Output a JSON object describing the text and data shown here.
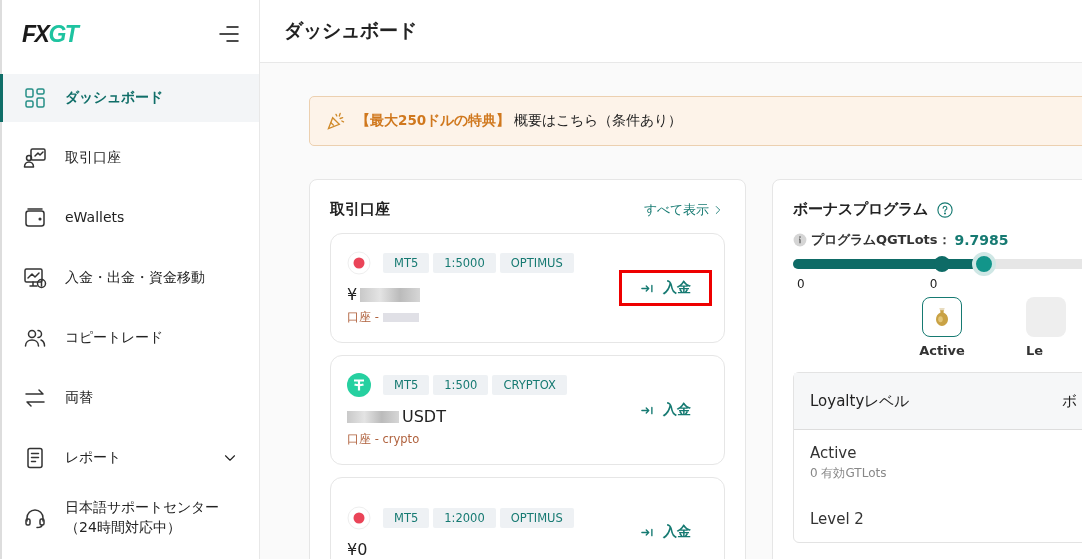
{
  "sidebar": {
    "logo": {
      "dark": "FX",
      "accent": "GT"
    },
    "items": [
      {
        "label": "ダッシュボード",
        "kind": "grid",
        "selected": true
      },
      {
        "label": "取引口座",
        "kind": "account",
        "selected": false
      },
      {
        "label": "eWallets",
        "kind": "wallet",
        "selected": false
      },
      {
        "label": "入金・出金・資金移動",
        "kind": "transfer",
        "selected": false
      },
      {
        "label": "コピートレード",
        "kind": "people",
        "selected": false
      },
      {
        "label": "両替",
        "kind": "exchange",
        "selected": false
      },
      {
        "label": "レポート",
        "kind": "report",
        "selected": false,
        "expanded": false
      },
      {
        "label": "日本語サポートセンター（24時間対応中）",
        "kind": "headset",
        "selected": false
      }
    ]
  },
  "header": {
    "title": "ダッシュボード"
  },
  "banner": {
    "text": "**【最大250ドルの特典】** 概要はこちら（条件あり）"
  },
  "accounts_card": {
    "title": "取引口座",
    "view_all": "すべて表示",
    "accounts": [
      {
        "kind": "jpy",
        "tags": [
          "MT5",
          "1:5000",
          "OPTIMUS"
        ],
        "balance": "¥",
        "balance_hidden": true,
        "account_label": "口座 -",
        "account_hidden": true,
        "deposit": "入金",
        "highlighted": true
      },
      {
        "kind": "usdt",
        "tags": [
          "MT5",
          "1:500",
          "CRYPTOX"
        ],
        "balance": "USDT",
        "balance_hidden": true,
        "account_label": "口座 - crypto",
        "account_hidden": false,
        "deposit": "入金",
        "highlighted": false
      },
      {
        "kind": "jpy",
        "tags": [
          "MT5",
          "1:2000",
          "OPTIMUS"
        ],
        "balance": "¥0",
        "balance_hidden": false,
        "deposit": "入金",
        "highlighted": false
      }
    ]
  },
  "bonus_card": {
    "title": "ボーナスプログラム",
    "lots_label": "プログラムQGTLots：",
    "lots_value": "9.7985",
    "slider": {
      "level": 0.33
    },
    "milestones": [
      "0",
      "0"
    ],
    "tiers": [
      {
        "label": "Active",
        "reached": true
      },
      {
        "label": "Le",
        "reached": false
      }
    ],
    "table": {
      "columns": [
        "Loyaltyレベル",
        "ボ"
      ],
      "rows": [
        {
          "name": "Active",
          "detail": "0 有効GTLots"
        },
        {
          "name": "Level 2"
        }
      ]
    }
  }
}
